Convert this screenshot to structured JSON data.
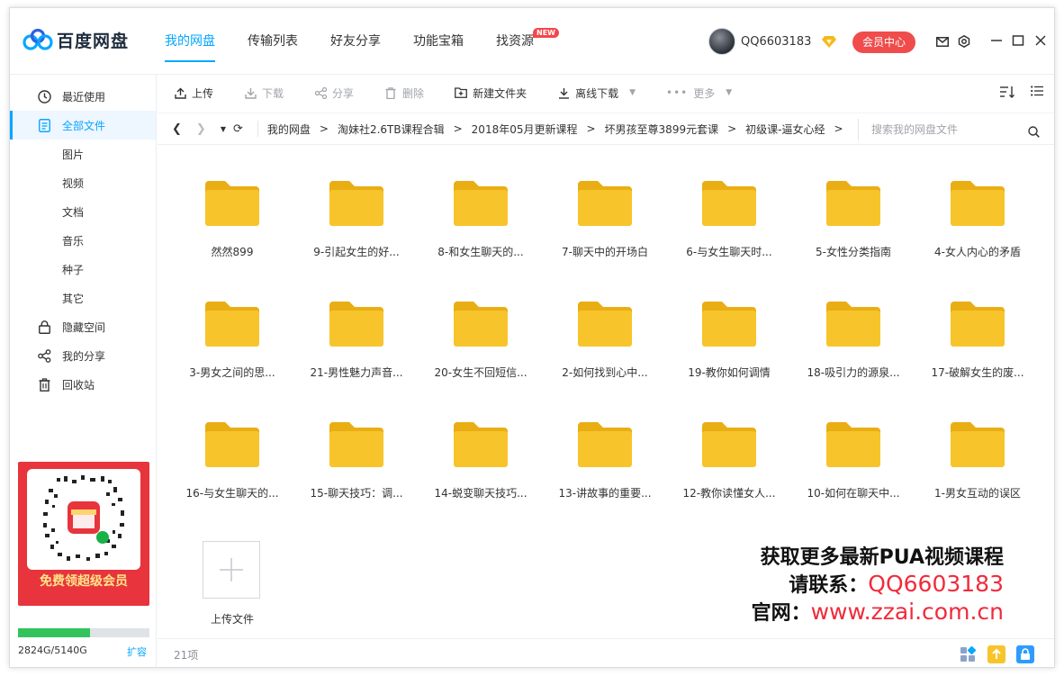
{
  "app": {
    "name": "百度网盘"
  },
  "nav": {
    "tabs": [
      {
        "label": "我的网盘",
        "active": true
      },
      {
        "label": "传输列表"
      },
      {
        "label": "好友分享"
      },
      {
        "label": "功能宝箱"
      },
      {
        "label": "找资源",
        "badge": "NEW"
      }
    ]
  },
  "user": {
    "name": "QQ6603183",
    "vip_button": "会员中心"
  },
  "sidebar": {
    "items": [
      {
        "label": "最近使用",
        "icon": "clock-icon"
      },
      {
        "label": "全部文件",
        "icon": "document-icon",
        "active": true
      },
      {
        "label": "图片"
      },
      {
        "label": "视频"
      },
      {
        "label": "文档"
      },
      {
        "label": "音乐"
      },
      {
        "label": "种子"
      },
      {
        "label": "其它"
      },
      {
        "label": "隐藏空间",
        "icon": "lock-icon"
      },
      {
        "label": "我的分享",
        "icon": "share-icon"
      },
      {
        "label": "回收站",
        "icon": "trash-icon"
      }
    ],
    "promo_text": "免费领超级会员",
    "storage_text": "2824G/5140G",
    "storage_fraction": 0.55,
    "expand_label": "扩容"
  },
  "toolbar": {
    "upload": "上传",
    "download": "下载",
    "share": "分享",
    "delete": "删除",
    "new_folder": "新建文件夹",
    "offline_download": "离线下载",
    "more": "更多"
  },
  "path": {
    "crumbs": [
      "我的网盘",
      "淘妹社2.6TB课程合辑",
      "2018年05月更新课程",
      "坏男孩至尊3899元套课",
      "初级课-逼女心经"
    ],
    "search_placeholder": "搜索我的网盘文件"
  },
  "files": [
    "然然899",
    "9-引起女生的好...",
    "8-和女生聊天的...",
    "7-聊天中的开场白",
    "6-与女生聊天时...",
    "5-女性分类指南",
    "4-女人内心的矛盾",
    "3-男女之间的思...",
    "21-男性魅力声音...",
    "20-女生不回短信...",
    "2-如何找到心中...",
    "19-教你如何调情",
    "18-吸引力的源泉...",
    "17-破解女生的废...",
    "16-与女生聊天的...",
    "15-聊天技巧：调...",
    "14-蜕变聊天技巧...",
    "13-讲故事的重要...",
    "12-教你读懂女人...",
    "10-如何在聊天中...",
    "1-男女互动的误区"
  ],
  "upload_tile_label": "上传文件",
  "ad": {
    "line1": "获取更多最新PUA视频课程",
    "line2_label": "请联系：",
    "line2_value": "QQ6603183",
    "line3_label": "官网：",
    "line3_value": "www.zzai.com.cn"
  },
  "status": {
    "count": "21项"
  },
  "colors": {
    "accent": "#06a7ff",
    "folder": "#f7c42b",
    "vip": "#ef4c4b",
    "promo": "#e8343c"
  }
}
